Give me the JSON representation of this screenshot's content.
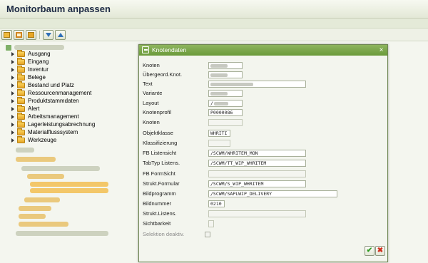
{
  "window": {
    "title": "Monitorbaum anpassen"
  },
  "toolbar": {
    "icons": [
      "folder-open-icon",
      "screen-icon",
      "folder-icon",
      "expand-icon",
      "collapse-icon"
    ]
  },
  "tree": {
    "items": [
      {
        "label": "Ausgang"
      },
      {
        "label": "Eingang"
      },
      {
        "label": "Inventur"
      },
      {
        "label": "Belege"
      },
      {
        "label": "Bestand und Platz"
      },
      {
        "label": "Ressourcenmanagement"
      },
      {
        "label": "Produktstammdaten"
      },
      {
        "label": "Alert"
      },
      {
        "label": "Arbeitsmanagement"
      },
      {
        "label": "Lagerleistungsabrechnung"
      },
      {
        "label": "Materialflusssystem"
      },
      {
        "label": "Werkzeuge"
      }
    ]
  },
  "dialog": {
    "title": "Knotendaten",
    "close": "×",
    "ok": "✔",
    "cancel": "✖",
    "fields": {
      "knoten": {
        "label": "Knoten"
      },
      "uebergeord": {
        "label": "Übergeord.Knot."
      },
      "text": {
        "label": "Text"
      },
      "variante": {
        "label": "Variante"
      },
      "layout": {
        "label": "Layout",
        "value": "/"
      },
      "knotenprofil": {
        "label": "Knotenprofil",
        "value": "P0000086"
      },
      "knoten2": {
        "label": "Knoten"
      },
      "objektklasse": {
        "label": "Objektklasse",
        "value": "WHRITI"
      },
      "klassifizierung": {
        "label": "Klassifizierung"
      },
      "fb_listensicht": {
        "label": "FB Listensicht",
        "value": "/SCWM/WHRITEM_MON"
      },
      "tabtyp": {
        "label": "TabTyp Listens.",
        "value": "/SCWM/TT_WIP_WHRITEM"
      },
      "fb_formsicht": {
        "label": "FB FormSicht"
      },
      "strukt_formular": {
        "label": "Strukt.Formular",
        "value": "/SCWM/S_WIP_WHRITEM"
      },
      "bildprogramm": {
        "label": "Bildprogramm",
        "value": "/SCWM/SAPLWIP_DELIVERY"
      },
      "bildnummer": {
        "label": "Bildnummer",
        "value": "0210"
      },
      "strukt_listens": {
        "label": "Strukt.Listens."
      },
      "sichtbarkeit": {
        "label": "Sichtbarkeit"
      },
      "selektion": {
        "label": "Selektion deaktiv."
      }
    }
  },
  "colors": {
    "dialog_header": "#7aa84a",
    "folder": "#efb93b",
    "ok": "#2c9a1f",
    "cancel": "#d0301f"
  }
}
